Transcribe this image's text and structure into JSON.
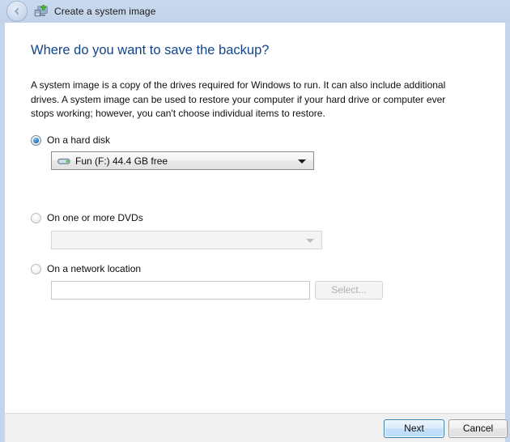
{
  "window": {
    "title": "Create a system image",
    "title_icon": "computer-backup-icon",
    "back_icon": "back-arrow-icon",
    "frame_color": "#c5d6ec",
    "titlebar_color": "#c5d6ec"
  },
  "page": {
    "heading": "Where do you want to save the backup?",
    "heading_color": "#13458a",
    "description": "A system image is a copy of the drives required for Windows to run. It can also include additional drives. A system image can be used to restore your computer if your hard drive or computer ever stops working; however, you can't choose individual items to restore."
  },
  "options": [
    {
      "id": "hard-disk",
      "label": "On a hard disk",
      "selected": true
    },
    {
      "id": "dvds",
      "label": "On one or more DVDs",
      "selected": false
    },
    {
      "id": "network",
      "label": "On a network location",
      "selected": false
    }
  ],
  "hard_disk_combo": {
    "value": "Fun (F:)  44.4 GB free",
    "icon": "hard-drive-icon",
    "enabled": true,
    "arrow_icon": "chevron-down-icon"
  },
  "dvd_combo": {
    "value": "",
    "enabled": false,
    "arrow_icon": "chevron-down-icon"
  },
  "network_location": {
    "value": "",
    "placeholder": "",
    "enabled": false,
    "select_button_label": "Select..."
  },
  "footer": {
    "next_label": "Next",
    "cancel_label": "Cancel"
  }
}
